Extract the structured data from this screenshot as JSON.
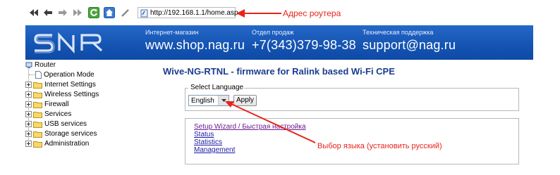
{
  "browser": {
    "url": "http://192.168.1.1/home.asp",
    "buttons": [
      "back-back-icon",
      "back-icon",
      "forward-icon",
      "forward-forward-icon",
      "refresh-icon",
      "home-icon",
      "edit-icon"
    ]
  },
  "annotations": {
    "router_address": "Адрес роутера",
    "language_choice": "Выбор языка (установить русский)",
    "color": "#e8231c"
  },
  "header": {
    "logo": "SNR",
    "shop_label": "Интернет-магазин",
    "shop_value": "www.shop.nag.ru",
    "sales_label": "Отдел продаж",
    "sales_value": "+7(343)379-98-38",
    "support_label": "Техническая поддержка",
    "support_value": "support@nag.ru",
    "bg_color": "#1655b4"
  },
  "tree": {
    "root": "Router",
    "items": [
      {
        "label": "Operation Mode",
        "type": "page"
      },
      {
        "label": "Internet Settings",
        "type": "folder"
      },
      {
        "label": "Wireless Settings",
        "type": "folder"
      },
      {
        "label": "Firewall",
        "type": "folder"
      },
      {
        "label": "Services",
        "type": "folder"
      },
      {
        "label": "USB services",
        "type": "folder"
      },
      {
        "label": "Storage services",
        "type": "folder"
      },
      {
        "label": "Administration",
        "type": "folder"
      }
    ]
  },
  "main": {
    "title": "Wive-NG-RTNL - firmware for Ralink based Wi-Fi CPE",
    "language": {
      "legend": "Select Language",
      "selected": "English",
      "apply_label": "Apply"
    },
    "links": [
      "Setup Wizard / Быстрая настройка",
      "Status",
      "Statistics",
      "Management"
    ]
  }
}
